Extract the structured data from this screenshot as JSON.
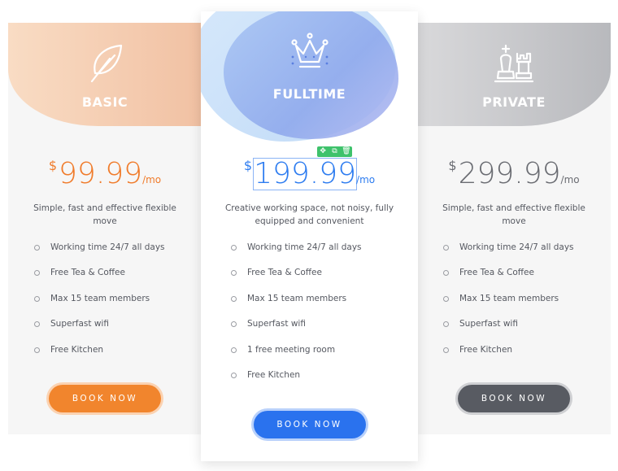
{
  "plans": [
    {
      "name": "BASIC",
      "icon": "feather-icon",
      "currency": "$",
      "amount": "99.99",
      "period": "/mo",
      "description": "Simple, fast and effective flexible move",
      "features": [
        "Working time 24/7 all days",
        "Free Tea & Coffee",
        "Max 15 team members",
        "Superfast wifi",
        "Free Kitchen"
      ],
      "button": "BOOK NOW",
      "accent": "#f1852d"
    },
    {
      "name": "FULLTIME",
      "icon": "crown-icon",
      "currency": "$",
      "amount": "199.99",
      "period": "/mo",
      "description": "Creative working space, not noisy, fully equipped and convenient",
      "features": [
        "Working time 24/7 all days",
        "Free Tea & Coffee",
        "Max 15 team members",
        "Superfast wifi",
        "1 free meeting room",
        "Free Kitchen"
      ],
      "button": "BOOK NOW",
      "accent": "#2a72ee"
    },
    {
      "name": "PRIVATE",
      "icon": "chess-pieces-icon",
      "currency": "$",
      "amount": "299.99",
      "period": "/mo",
      "description": "Simple, fast and effective flexible move",
      "features": [
        "Working time 24/7 all days",
        "Free Tea & Coffee",
        "Max 15 team members",
        "Superfast wifi",
        "Free Kitchen"
      ],
      "button": "BOOK NOW",
      "accent": "#585b62"
    }
  ],
  "editor_toolbar": {
    "icons": [
      "move-icon",
      "duplicate-icon",
      "delete-icon"
    ],
    "move_glyph": "✥",
    "duplicate_glyph": "⧉",
    "delete_glyph": "🗑"
  }
}
